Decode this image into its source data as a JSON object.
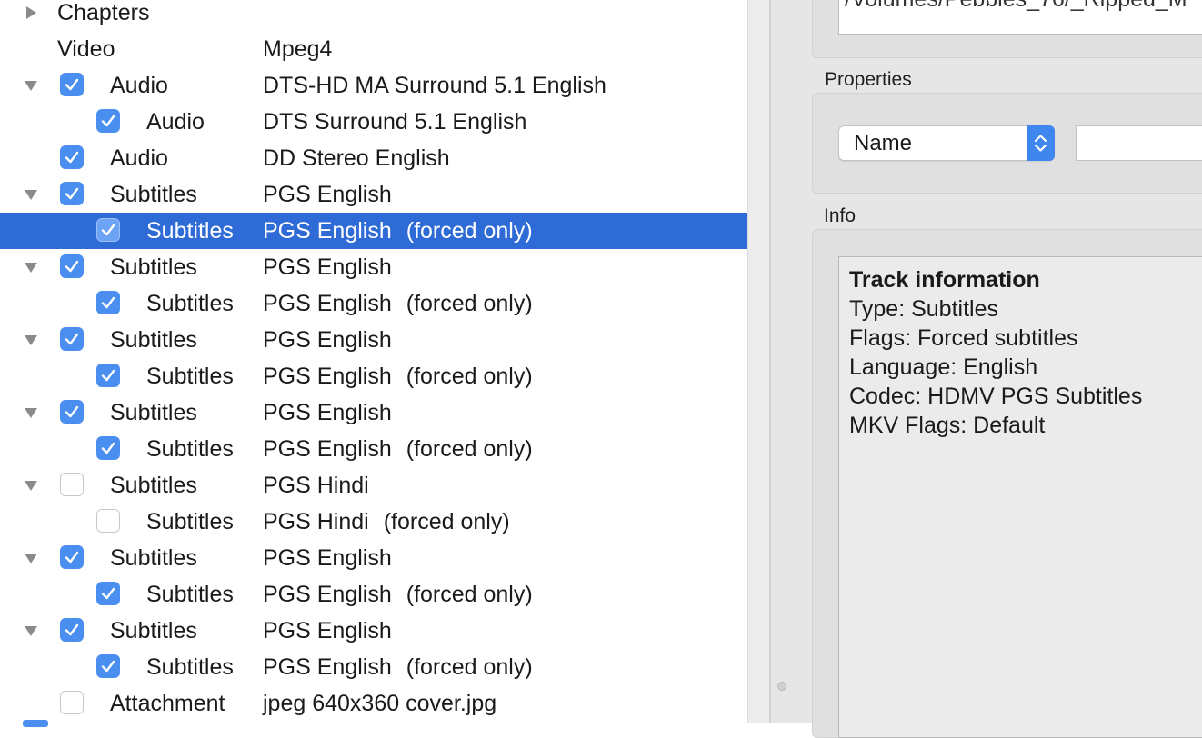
{
  "tracks": [
    {
      "disclosure": "right",
      "checkbox": "none",
      "type": "Chapters",
      "description": "",
      "suffix": "",
      "indent": 0
    },
    {
      "disclosure": "none",
      "checkbox": "none",
      "type": "Video",
      "description": "Mpeg4",
      "suffix": "",
      "indent": 0
    },
    {
      "disclosure": "down",
      "checkbox": "checked",
      "type": "Audio",
      "description": "DTS-HD MA Surround 5.1 English",
      "suffix": "",
      "indent": 0
    },
    {
      "disclosure": "none",
      "checkbox": "checked",
      "type": "Audio",
      "description": "DTS Surround 5.1 English",
      "suffix": "",
      "indent": 1
    },
    {
      "disclosure": "none",
      "checkbox": "checked",
      "type": "Audio",
      "description": "DD Stereo English",
      "suffix": "",
      "indent": 0
    },
    {
      "disclosure": "down",
      "checkbox": "checked",
      "type": "Subtitles",
      "description": "PGS English",
      "suffix": "",
      "indent": 0
    },
    {
      "disclosure": "none",
      "checkbox": "checked",
      "type": "Subtitles",
      "description": "PGS English",
      "suffix": "(forced only)",
      "indent": 1,
      "selected": true
    },
    {
      "disclosure": "down",
      "checkbox": "checked",
      "type": "Subtitles",
      "description": "PGS English",
      "suffix": "",
      "indent": 0
    },
    {
      "disclosure": "none",
      "checkbox": "checked",
      "type": "Subtitles",
      "description": "PGS English",
      "suffix": "(forced only)",
      "indent": 1
    },
    {
      "disclosure": "down",
      "checkbox": "checked",
      "type": "Subtitles",
      "description": "PGS English",
      "suffix": "",
      "indent": 0
    },
    {
      "disclosure": "none",
      "checkbox": "checked",
      "type": "Subtitles",
      "description": "PGS English",
      "suffix": "(forced only)",
      "indent": 1
    },
    {
      "disclosure": "down",
      "checkbox": "checked",
      "type": "Subtitles",
      "description": "PGS English",
      "suffix": "",
      "indent": 0
    },
    {
      "disclosure": "none",
      "checkbox": "checked",
      "type": "Subtitles",
      "description": "PGS English",
      "suffix": "(forced only)",
      "indent": 1
    },
    {
      "disclosure": "down",
      "checkbox": "unchecked",
      "type": "Subtitles",
      "description": "PGS Hindi",
      "suffix": "",
      "indent": 0
    },
    {
      "disclosure": "none",
      "checkbox": "unchecked",
      "type": "Subtitles",
      "description": "PGS Hindi",
      "suffix": "(forced only)",
      "indent": 1
    },
    {
      "disclosure": "down",
      "checkbox": "checked",
      "type": "Subtitles",
      "description": "PGS English",
      "suffix": "",
      "indent": 0
    },
    {
      "disclosure": "none",
      "checkbox": "checked",
      "type": "Subtitles",
      "description": "PGS English",
      "suffix": "(forced only)",
      "indent": 1
    },
    {
      "disclosure": "down",
      "checkbox": "checked",
      "type": "Subtitles",
      "description": "PGS English",
      "suffix": "",
      "indent": 0
    },
    {
      "disclosure": "none",
      "checkbox": "checked",
      "type": "Subtitles",
      "description": "PGS English",
      "suffix": "(forced only)",
      "indent": 1
    },
    {
      "disclosure": "none",
      "checkbox": "unchecked",
      "type": "Attachment",
      "description": "jpeg 640x360 cover.jpg",
      "suffix": "",
      "indent": 0
    }
  ],
  "source": {
    "path_partial": "/Volumes/Pebbles_76/_Ripped_M"
  },
  "properties": {
    "label": "Properties",
    "selected_property": "Name",
    "value": ""
  },
  "info": {
    "label": "Info",
    "title": "Track information",
    "lines": [
      "Type: Subtitles",
      "Flags: Forced subtitles",
      "Language: English",
      "Codec: HDMV PGS Subtitles",
      "MKV Flags: Default"
    ]
  },
  "icons": {
    "expanded": "disclosure-triangle-down-icon",
    "collapsed": "disclosure-triangle-right-icon",
    "checkmark": "checkmark-icon",
    "popup": "popup-chevrons-icon"
  },
  "colors": {
    "selection": "#2e6bd6",
    "checkbox_checked": "#4a8ff0",
    "panel_bg": "#e6e6e6"
  }
}
